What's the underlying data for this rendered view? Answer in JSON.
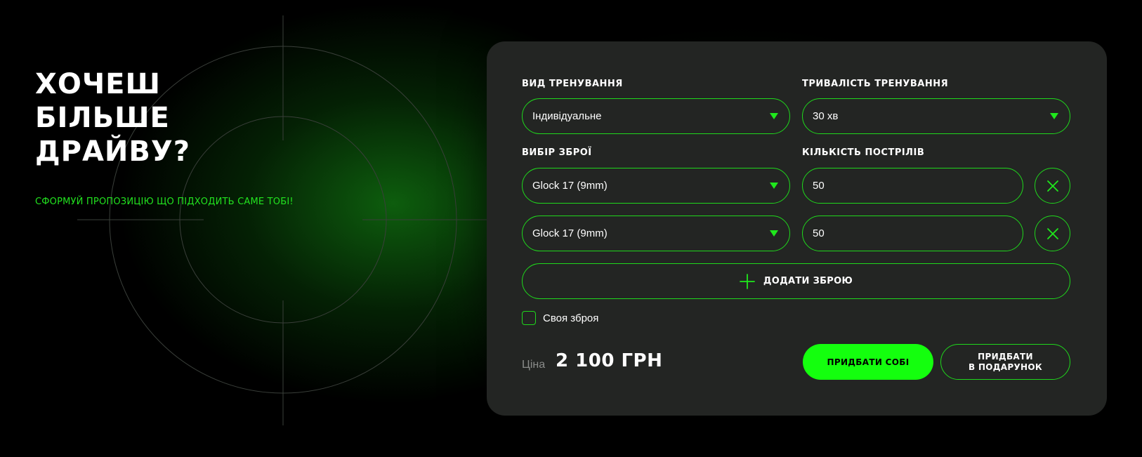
{
  "hero": {
    "title_line1": "ХОЧЕШ БІЛЬШЕ",
    "title_line2": "ДРАЙВУ?",
    "subtitle": "СФОРМУЙ ПРОПОЗИЦІЮ ЩО ПІДХОДИТЬ САМЕ ТОБІ!"
  },
  "form": {
    "training_type": {
      "label": "ВИД ТРЕНУВАННЯ",
      "value": "Індивідуальне"
    },
    "training_duration": {
      "label": "ТРИВАЛІСТЬ ТРЕНУВАННЯ",
      "value": "30 хв"
    },
    "weapon_label": "ВИБІР ЗБРОЇ",
    "shots_label": "КІЛЬКІСТЬ ПОСТРІЛІВ",
    "weapon_rows": [
      {
        "weapon": "Glock 17 (9mm)",
        "shots": "50"
      },
      {
        "weapon": "Glock 17 (9mm)",
        "shots": "50"
      }
    ],
    "add_weapon_label": "ДОДАТИ ЗБРОЮ",
    "own_weapon_label": "Своя зброя",
    "own_weapon_checked": false
  },
  "pricing": {
    "label": "Ціна",
    "value": "2 100 ГРН"
  },
  "actions": {
    "buy_label": "ПРИДБАТИ СОБІ",
    "gift_line1": "ПРИДБАТИ",
    "gift_line2": "В ПОДАРУНОК"
  },
  "colors": {
    "accent": "#14ff0e",
    "card_bg": "#232523",
    "page_bg": "#000000"
  },
  "icons": {
    "dropdown": "chevron-down-icon",
    "remove": "close-icon",
    "add": "plus-icon"
  }
}
